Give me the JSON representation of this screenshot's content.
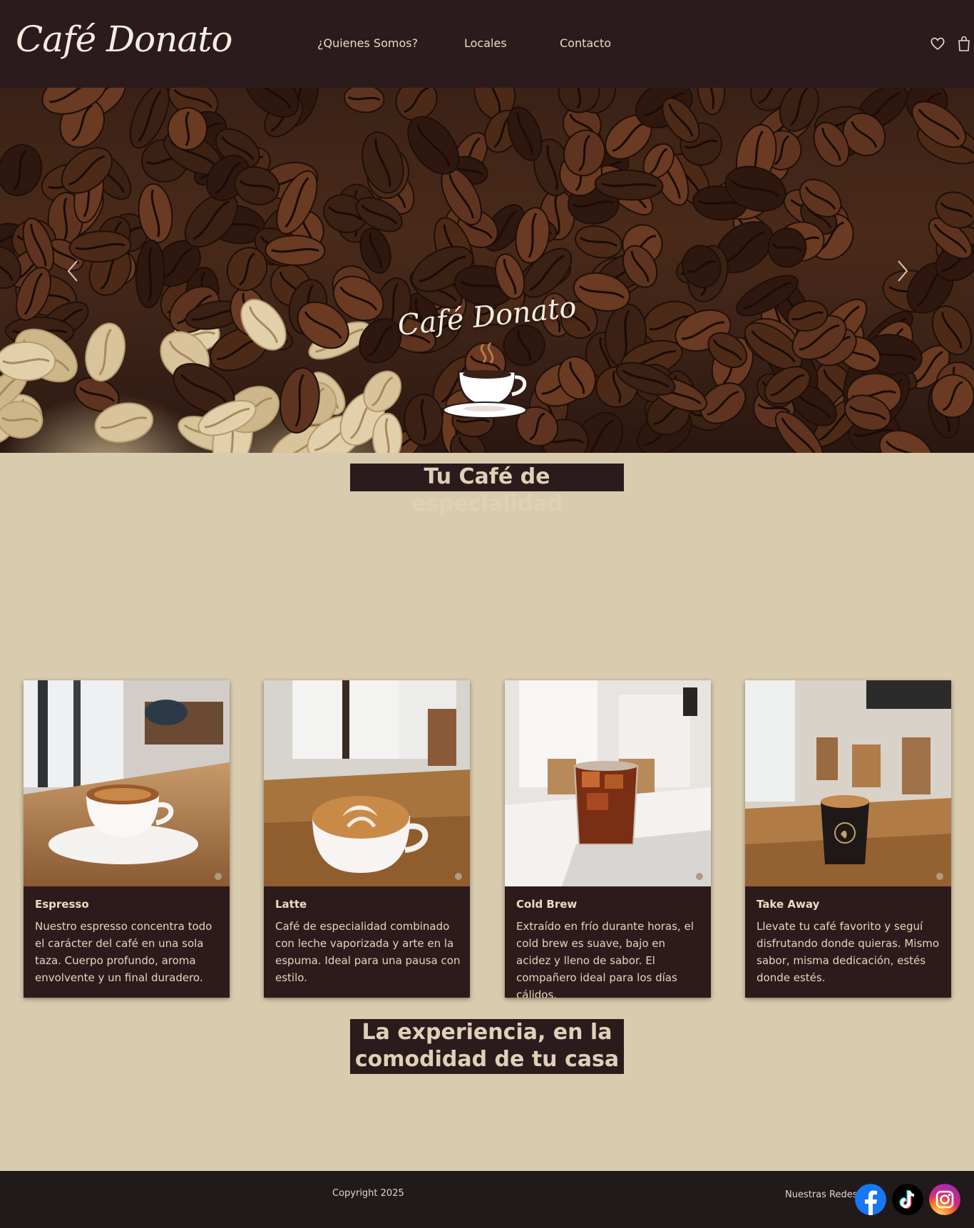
{
  "header": {
    "brand": "Café Donato",
    "nav": [
      "¿Quienes Somos?",
      "Locales",
      "Contacto"
    ],
    "icons": [
      "heart-icon",
      "shopping-bag-icon"
    ]
  },
  "hero": {
    "logo_text": "Café Donato",
    "prev_icon": "chevron-left-icon",
    "next_icon": "chevron-right-icon"
  },
  "section1": {
    "heading": "Tu Café de especialidad"
  },
  "cards": [
    {
      "title": "Espresso",
      "description": "Nuestro espresso concentra todo el carácter del café en una sola taza. Cuerpo profundo, aroma envolvente y un final duradero."
    },
    {
      "title": "Latte",
      "description": "Café de especialidad combinado con leche vaporizada y arte en la espuma. Ideal para una pausa con estilo."
    },
    {
      "title": "Cold Brew",
      "description": "Extraído en frío durante horas, el cold brew es suave, bajo en acidez y lleno de sabor. El compañero ideal para los días cálidos."
    },
    {
      "title": "Take Away",
      "description": "Llevate tu café favorito y seguí disfrutando donde quieras. Mismo sabor, misma dedicación, estés donde estés."
    }
  ],
  "section2": {
    "heading": "La experiencia, en la comodidad de tu casa"
  },
  "footer": {
    "copyright": "Copyright 2025",
    "social_label": "Nuestras Redes",
    "social": [
      "facebook-icon",
      "tiktok-icon",
      "instagram-icon"
    ]
  },
  "colors": {
    "background": "#d9cbad",
    "dark": "#2b1b1c",
    "footer": "#201a1b",
    "facebook": "#1877f2",
    "instagram": "#d62976"
  }
}
